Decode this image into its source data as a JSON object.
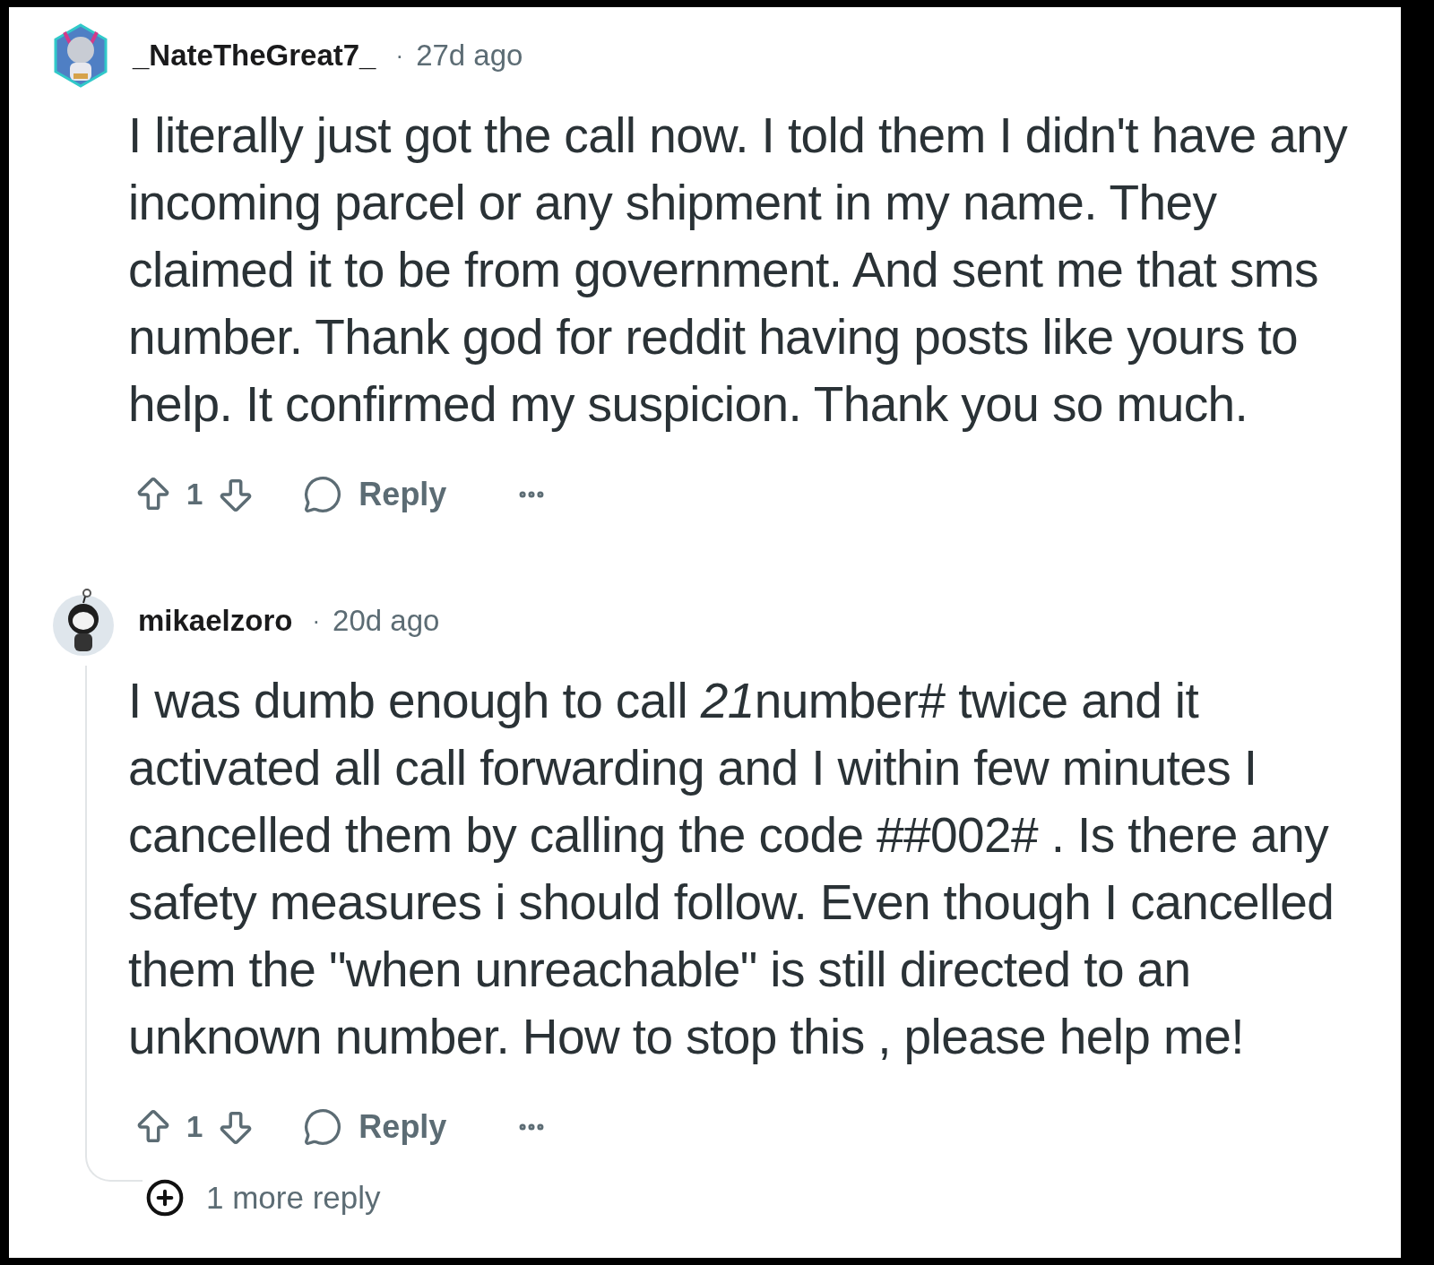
{
  "comments": [
    {
      "author": "_NateTheGreat7_",
      "separator": "·",
      "time": "27d ago",
      "avatar": {
        "kind": "hexagon"
      },
      "body": "I literally just got the call now. I told them I didn't have any incoming parcel or any shipment in my name. They claimed it to be from government. And sent me that sms number. Thank god for reddit having posts like yours to help. It confirmed my suspicion. Thank you so much.",
      "votes": "1",
      "reply_label": "Reply"
    },
    {
      "author": "mikaelzoro",
      "separator": "·",
      "time": "20d ago",
      "avatar": {
        "kind": "circle"
      },
      "body": [
        {
          "text": "I was dumb enough to call ",
          "italic": false
        },
        {
          "text": "21",
          "italic": true
        },
        {
          "text": "number# twice and it activated all call forwarding and I within few minutes I cancelled them by calling the code ##002# . Is there any safety measures i should follow. Even though I cancelled them the \"when unreachable\" is still directed to an unknown number. How to stop this , please help me!",
          "italic": false
        }
      ],
      "votes": "1",
      "reply_label": "Reply",
      "more_replies": "1 more reply"
    }
  ]
}
